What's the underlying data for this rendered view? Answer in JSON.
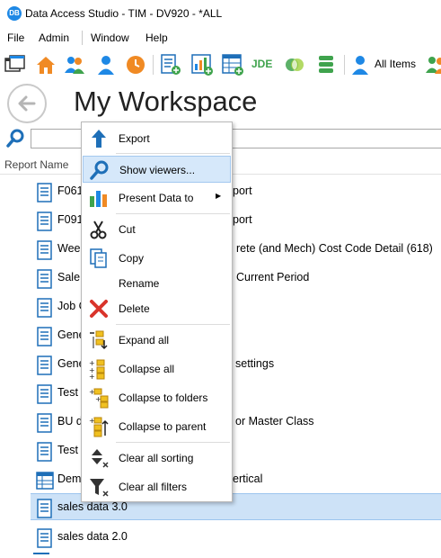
{
  "app": {
    "logo_text": "DB",
    "window_title": "Data Access Studio - TIM - DV920 - *ALL"
  },
  "menu": {
    "file": "File",
    "admin": "Admin",
    "window": "Window",
    "help": "Help"
  },
  "toolbar": {
    "jde_label": "JDE",
    "all_items_label": "All Items",
    "icons": [
      "new-window-icon",
      "home-icon",
      "users-icon",
      "user-icon",
      "clock-icon",
      "new-report-icon",
      "new-chart-icon",
      "new-grid-icon",
      "jde-icon",
      "venn-icon",
      "database-icon",
      "user-blue-icon",
      "users-green-icon"
    ]
  },
  "header": {
    "title": "My Workspace"
  },
  "search": {
    "placeholder": ""
  },
  "table": {
    "column_header": "Report Name",
    "rows": [
      {
        "icon": "report-icon",
        "label": "F061",
        "tail": "port"
      },
      {
        "icon": "report-icon",
        "label": "F091",
        "tail": "port"
      },
      {
        "icon": "report-icon",
        "label": "Wee",
        "tail": "rete (and Mech) Cost Code Detail (618)"
      },
      {
        "icon": "report-icon",
        "label": "Sale",
        "tail": "Current Period"
      },
      {
        "icon": "report-icon",
        "label": "Job C",
        "tail": ""
      },
      {
        "icon": "report-icon",
        "label": "Gene",
        "tail": ""
      },
      {
        "icon": "report-icon",
        "label": "Gene",
        "tail": "settings"
      },
      {
        "icon": "report-icon",
        "label": "Test",
        "tail": ""
      },
      {
        "icon": "report-icon",
        "label": "BU d",
        "tail": "or Master Class"
      },
      {
        "icon": "report-icon",
        "label": "Test",
        "tail": ""
      },
      {
        "icon": "grid-report-icon",
        "label": "Dem",
        "tail": "ertical"
      },
      {
        "icon": "report-icon",
        "label": "sales data 3.0",
        "tail": "",
        "selected": true
      },
      {
        "icon": "report-icon",
        "label": "sales data 2.0",
        "tail": ""
      }
    ]
  },
  "context_menu": {
    "items": [
      {
        "label": "Export",
        "icon": "export-arrow-icon"
      },
      {
        "label": "Show viewers...",
        "icon": "magnifier-icon",
        "highlighted": true
      },
      {
        "label": "Present Data to",
        "icon": "bar-chart-icon",
        "submenu": true
      },
      {
        "label": "Cut",
        "icon": "scissors-icon"
      },
      {
        "label": "Copy",
        "icon": "copy-icon"
      },
      {
        "label": "Rename",
        "icon": ""
      },
      {
        "label": "Delete",
        "icon": "delete-x-icon"
      },
      {
        "label": "Expand all",
        "icon": "expand-all-icon"
      },
      {
        "label": "Collapse all",
        "icon": "collapse-all-icon"
      },
      {
        "label": "Collapse to folders",
        "icon": "collapse-folders-icon"
      },
      {
        "label": "Collapse to parent",
        "icon": "collapse-parent-icon"
      },
      {
        "label": "Clear all sorting",
        "icon": "clear-sort-icon"
      },
      {
        "label": "Clear all filters",
        "icon": "clear-filter-icon"
      }
    ]
  },
  "colors": {
    "accent_blue": "#1e88e5",
    "selection": "#cde2f7",
    "menu_highlight": "#d6e8fa",
    "delete_red": "#d9342b"
  }
}
